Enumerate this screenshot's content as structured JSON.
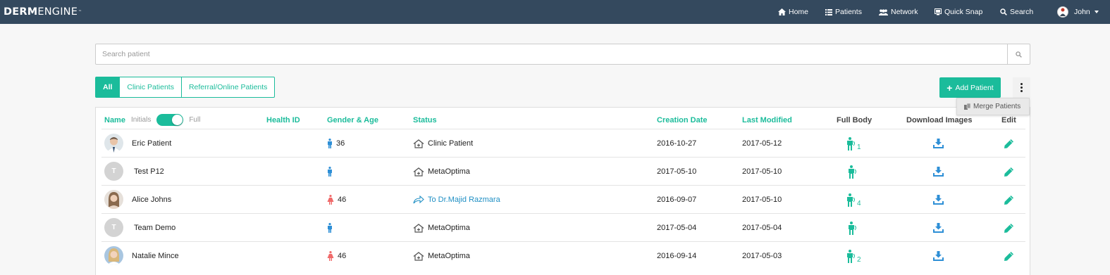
{
  "navbar": {
    "logo_bold": "DERM",
    "logo_light": "ENGINE",
    "logo_tm": "™",
    "items": [
      {
        "label": "Home",
        "icon": "home-icon"
      },
      {
        "label": "Patients",
        "icon": "list-icon"
      },
      {
        "label": "Network",
        "icon": "users-icon"
      },
      {
        "label": "Quick Snap",
        "icon": "camera-icon"
      },
      {
        "label": "Search",
        "icon": "search-icon"
      }
    ],
    "user": {
      "name": "John",
      "icon": "user-avatar-icon"
    }
  },
  "search": {
    "placeholder": "Search patient",
    "value": "",
    "icon": "search-icon"
  },
  "filters": [
    {
      "label": "All",
      "active": true
    },
    {
      "label": "Clinic Patients",
      "active": false
    },
    {
      "label": "Referral/Online Patients",
      "active": false
    }
  ],
  "add_patient_label": "Add Patient",
  "menu": {
    "merge_label": "Merge Patients",
    "icon": "merge-icon"
  },
  "table": {
    "columns": {
      "name": "Name",
      "toggle_initials": "Initials",
      "toggle_full": "Full",
      "health_id": "Health ID",
      "gender_age": "Gender & Age",
      "status": "Status",
      "creation_date": "Creation Date",
      "last_modified": "Last Modified",
      "full_body": "Full Body",
      "download_images": "Download Images",
      "edit": "Edit"
    },
    "name_toggle_state": "Full",
    "rows": [
      {
        "avatar": "photo",
        "initial": "",
        "name": "Eric Patient",
        "health_id": "",
        "gender": "male",
        "age": "36",
        "status_type": "clinic",
        "status": "Clinic Patient",
        "creation_date": "2016-10-27",
        "last_modified": "2017-05-12",
        "full_body_count": "1"
      },
      {
        "avatar": "letter",
        "initial": "T",
        "name": "Test P12",
        "health_id": "",
        "gender": "male",
        "age": "",
        "status_type": "clinic",
        "status": "MetaOptima",
        "creation_date": "2017-05-10",
        "last_modified": "2017-05-10",
        "full_body_count": ""
      },
      {
        "avatar": "photo",
        "initial": "",
        "name": "Alice Johns",
        "health_id": "",
        "gender": "female",
        "age": "46",
        "status_type": "referral",
        "status": "To Dr.Majid Razmara",
        "creation_date": "2016-09-07",
        "last_modified": "2017-05-10",
        "full_body_count": "4"
      },
      {
        "avatar": "letter",
        "initial": "T",
        "name": "Team Demo",
        "health_id": "",
        "gender": "male",
        "age": "",
        "status_type": "clinic",
        "status": "MetaOptima",
        "creation_date": "2017-05-04",
        "last_modified": "2017-05-04",
        "full_body_count": ""
      },
      {
        "avatar": "photo",
        "initial": "",
        "name": "Natalie Mince",
        "health_id": "",
        "gender": "female",
        "age": "46",
        "status_type": "clinic",
        "status": "MetaOptima",
        "creation_date": "2016-09-14",
        "last_modified": "2017-05-03",
        "full_body_count": "2"
      }
    ]
  },
  "colors": {
    "navbar": "#34495e",
    "accent": "#1bbc9b",
    "male": "#2e8fd6",
    "female": "#f06a6a",
    "link": "#1f8fc4"
  }
}
